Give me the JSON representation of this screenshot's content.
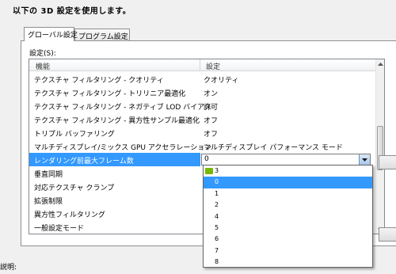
{
  "header": {
    "title": "以下の 3D 設定を使用します。"
  },
  "tabs": [
    {
      "label": "グローバル設定",
      "active": true
    },
    {
      "label": "プログラム設定",
      "active": false
    }
  ],
  "panel": {
    "settings_label": "設定(S):",
    "columns": {
      "feature": "機能",
      "setting": "設定"
    },
    "rows": [
      {
        "feature": "テクスチャ フィルタリング - クオリティ",
        "setting": "クオリティ"
      },
      {
        "feature": "テクスチャ フィルタリング - トリリニア最適化",
        "setting": "オン"
      },
      {
        "feature": "テクスチャ フィルタリング - ネガティブ LOD バイアス",
        "setting": "許可"
      },
      {
        "feature": "テクスチャ フィルタリング - 異方性サンプル最適化",
        "setting": "オフ"
      },
      {
        "feature": "トリプル バッファリング",
        "setting": "オフ"
      },
      {
        "feature": "マルチディスプレイ/ミックス GPU アクセラレーション",
        "setting": "マルチディスプレイ パフォーマンス モード"
      },
      {
        "feature": "レンダリング前最大フレーム数",
        "setting": "0",
        "selected": true
      },
      {
        "feature": "垂直同期",
        "setting": ""
      },
      {
        "feature": "対応テクスチャ クランプ",
        "setting": ""
      },
      {
        "feature": "拡張制限",
        "setting": ""
      },
      {
        "feature": "異方性フィルタリング",
        "setting": ""
      },
      {
        "feature": "一般設定モード",
        "setting": ""
      }
    ]
  },
  "dropdown": {
    "options": [
      {
        "label": "3",
        "icon": "nvidia-icon"
      },
      {
        "label": "0",
        "highlight": true
      },
      {
        "label": "1"
      },
      {
        "label": "2"
      },
      {
        "label": "4"
      },
      {
        "label": "5"
      },
      {
        "label": "6"
      },
      {
        "label": "7"
      },
      {
        "label": "8"
      }
    ]
  },
  "footer": {
    "description_label": "説明:"
  },
  "colors": {
    "selection": "#3399ff",
    "nvidia_green": "#76b900"
  }
}
